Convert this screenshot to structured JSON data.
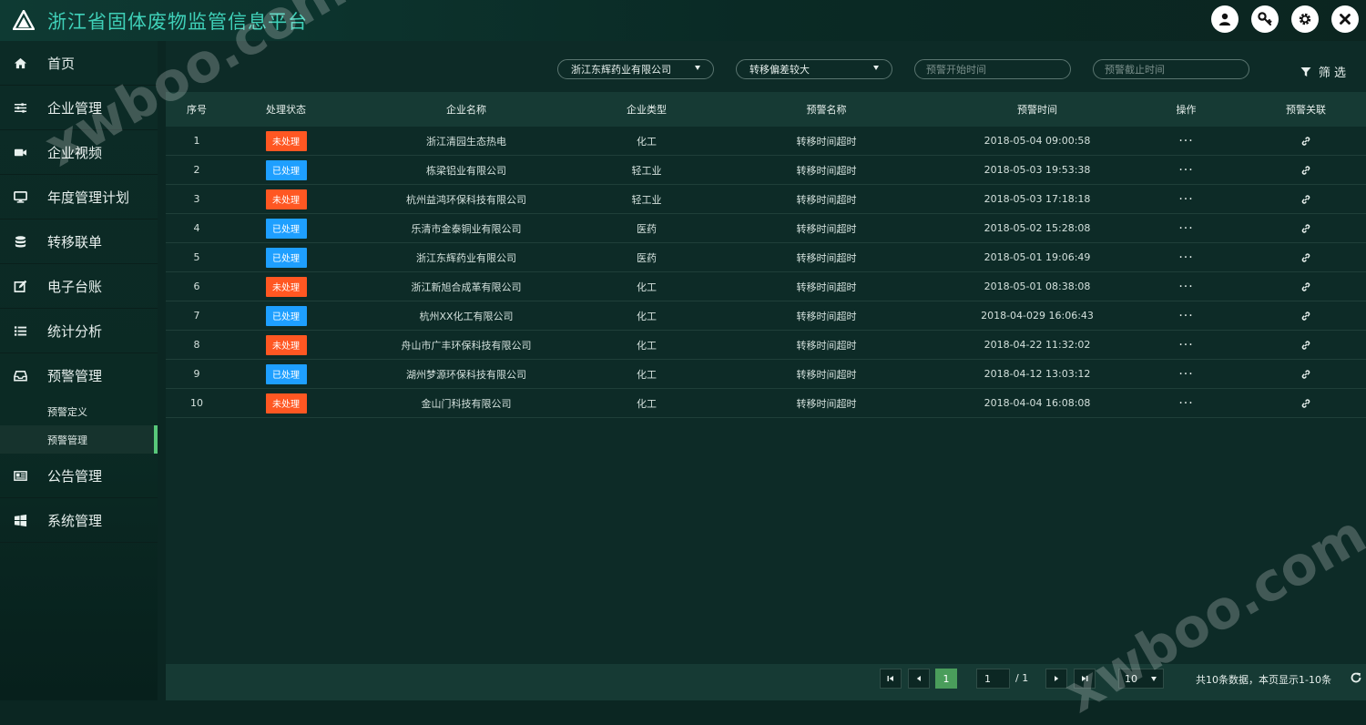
{
  "app": {
    "title": "浙江省固体废物监管信息平台"
  },
  "sidebar": {
    "items": [
      {
        "label": "首页",
        "icon": "home-icon"
      },
      {
        "label": "企业管理",
        "icon": "sliders-icon"
      },
      {
        "label": "企业视频",
        "icon": "video-icon"
      },
      {
        "label": "年度管理计划",
        "icon": "monitor-icon"
      },
      {
        "label": "转移联单",
        "icon": "database-icon"
      },
      {
        "label": "电子台账",
        "icon": "edit-icon"
      },
      {
        "label": "统计分析",
        "icon": "list-icon"
      },
      {
        "label": "预警管理",
        "icon": "inbox-icon"
      }
    ],
    "sub_items": [
      {
        "label": "预警定义",
        "active": false
      },
      {
        "label": "预警管理",
        "active": true
      }
    ],
    "items_after": [
      {
        "label": "公告管理",
        "icon": "newspaper-icon"
      },
      {
        "label": "系统管理",
        "icon": "windows-icon"
      }
    ]
  },
  "filters": {
    "company_select": "浙江东辉药业有限公司",
    "type_select": "转移偏差较大",
    "start_placeholder": "预警开始时间",
    "end_placeholder": "预警截止时间",
    "filter_label": "筛 选"
  },
  "table": {
    "headers": [
      "序号",
      "处理状态",
      "企业名称",
      "企业类型",
      "预警名称",
      "预警时间",
      "操作",
      "预警关联"
    ],
    "rows": [
      {
        "no": "1",
        "status": "未处理",
        "company": "浙江清园生态热电",
        "type": "化工",
        "warning": "转移时间超时",
        "time": "2018-05-04 09:00:58"
      },
      {
        "no": "2",
        "status": "已处理",
        "company": "栋梁铝业有限公司",
        "type": "轻工业",
        "warning": "转移时间超时",
        "time": "2018-05-03 19:53:38"
      },
      {
        "no": "3",
        "status": "未处理",
        "company": "杭州益鸿环保科技有限公司",
        "type": "轻工业",
        "warning": "转移时间超时",
        "time": "2018-05-03 17:18:18"
      },
      {
        "no": "4",
        "status": "已处理",
        "company": "乐清市金泰铜业有限公司",
        "type": "医药",
        "warning": "转移时间超时",
        "time": "2018-05-02 15:28:08"
      },
      {
        "no": "5",
        "status": "已处理",
        "company": "浙江东辉药业有限公司",
        "type": "医药",
        "warning": "转移时间超时",
        "time": "2018-05-01 19:06:49"
      },
      {
        "no": "6",
        "status": "未处理",
        "company": "浙江新旭合成革有限公司",
        "type": "化工",
        "warning": "转移时间超时",
        "time": "2018-05-01 08:38:08"
      },
      {
        "no": "7",
        "status": "已处理",
        "company": "杭州XX化工有限公司",
        "type": "化工",
        "warning": "转移时间超时",
        "time": "2018-04-029 16:06:43"
      },
      {
        "no": "8",
        "status": "未处理",
        "company": "舟山市广丰环保科技有限公司",
        "type": "化工",
        "warning": "转移时间超时",
        "time": "2018-04-22 11:32:02"
      },
      {
        "no": "9",
        "status": "已处理",
        "company": "湖州梦源环保科技有限公司",
        "type": "化工",
        "warning": "转移时间超时",
        "time": "2018-04-12 13:03:12"
      },
      {
        "no": "10",
        "status": "未处理",
        "company": "金山门科技有限公司",
        "type": "化工",
        "warning": "转移时间超时",
        "time": "2018-04-04 16:08:08"
      }
    ],
    "more_glyph": "···"
  },
  "pagination": {
    "current": "1",
    "page_input": "1",
    "total_pages": "/ 1",
    "page_size": "10",
    "summary": "共10条数据，本页显示1-10条"
  },
  "watermark": {
    "text": "xwboo.com"
  },
  "colors": {
    "pending": "#ff5722",
    "done": "#1e9fff",
    "accent": "#3fd0b8",
    "active_bar": "#58c87a"
  }
}
